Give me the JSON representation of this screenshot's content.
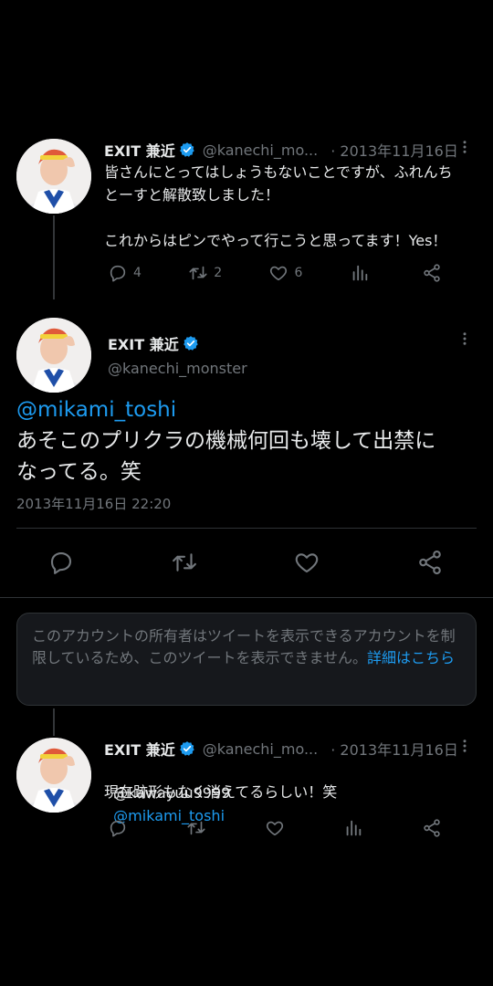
{
  "tweet1": {
    "name": "EXIT 兼近",
    "handle": "@kanechi_mo...",
    "date": "· 2013年11月16日",
    "text": "皆さんにとってはしょうもないことですが、ふれんち\nとーすと解散致しました！\n\nこれからはピンでやって行こうと思ってます！Yes！",
    "replies": "4",
    "retweets": "2",
    "likes": "6"
  },
  "main_tweet": {
    "name": "EXIT 兼近",
    "handle": "@kanechi_monster",
    "mention": "@mikami_toshi",
    "text": "あそこのプリクラの機械何回も壊して出禁に\nなってる。笑",
    "timestamp": "2013年11月16日 22:20"
  },
  "notice": {
    "text": "このアカウントの所有者はツイートを表示できるアカウントを制限しているため、このツイートを表示できません。",
    "link": "詳細はこちら"
  },
  "tweet3": {
    "name": "EXIT 兼近",
    "handle": "@kanechi_mo...",
    "date": "· 2013年11月16日",
    "mention1": "@kawayuu9999",
    "mention2": "@mikami_toshi",
    "text": "現在跡形もなく消えてるらしい！笑"
  },
  "colors": {
    "background": "#000000",
    "text": "#e7e9ea",
    "secondary": "#71767b",
    "accent": "#1d9bf0",
    "verified": "#1d9bf0"
  }
}
